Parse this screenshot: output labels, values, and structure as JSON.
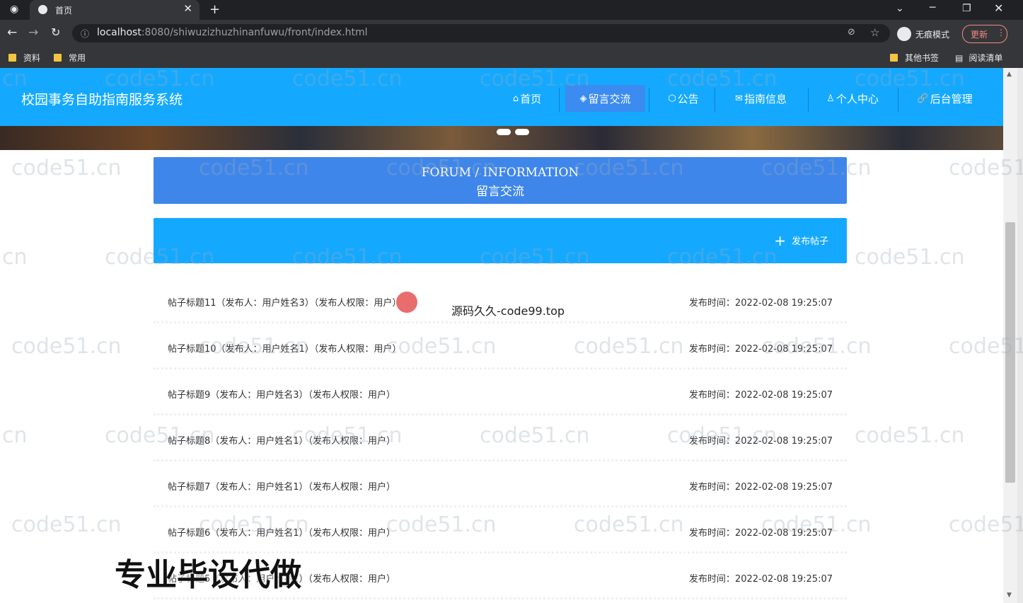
{
  "browser": {
    "tab_title": "首页",
    "url_host": "localhost",
    "url_path": ":8080/shiwuzizhuzhinanfuwu/front/index.html",
    "bookmarks": [
      "资料",
      "常用"
    ],
    "bookmarks_right": [
      "其他书签",
      "阅读清单"
    ],
    "incognito_label": "无痕模式",
    "update_label": "更新"
  },
  "nav": {
    "site_title": "校园事务自助指南服务系统",
    "items": [
      {
        "icon": "home-icon",
        "glyph": "⌂",
        "label": "首页"
      },
      {
        "icon": "tag-icon",
        "glyph": "◈",
        "label": "留言交流"
      },
      {
        "icon": "box-icon",
        "glyph": "⬡",
        "label": "公告"
      },
      {
        "icon": "mail-icon",
        "glyph": "✉",
        "label": "指南信息"
      },
      {
        "icon": "user-icon",
        "glyph": "♙",
        "label": "个人中心"
      },
      {
        "icon": "link-icon",
        "glyph": "🔗",
        "label": "后台管理"
      }
    ],
    "active_index": 1
  },
  "header": {
    "title_en": "FORUM / INFORMATION",
    "title_cn": "留言交流"
  },
  "actions": {
    "add_label": "发布帖子"
  },
  "posts": [
    {
      "title": "帖子标题11（发布人：用户姓名3）（发布人权限：用户）",
      "time": "发布时间：2022-02-08 19:25:07"
    },
    {
      "title": "帖子标题10（发布人：用户姓名1）（发布人权限：用户）",
      "time": "发布时间：2022-02-08 19:25:07"
    },
    {
      "title": "帖子标题9（发布人：用户姓名3）（发布人权限：用户）",
      "time": "发布时间：2022-02-08 19:25:07"
    },
    {
      "title": "帖子标题8（发布人：用户姓名1）（发布人权限：用户）",
      "time": "发布时间：2022-02-08 19:25:07"
    },
    {
      "title": "帖子标题7（发布人：用户姓名1）（发布人权限：用户）",
      "time": "发布时间：2022-02-08 19:25:07"
    },
    {
      "title": "帖子标题6（发布人：用户姓名1）（发布人权限：用户）",
      "time": "发布时间：2022-02-08 19:25:07"
    },
    {
      "title": "帖子标题5（发布人：用户姓名1）（发布人权限：用户）",
      "time": "发布时间：2022-02-08 19:25:07"
    }
  ],
  "overlays": {
    "watermark": "code51.cn",
    "code_text": "源码久久-code99.top",
    "big_text": "专业毕设代做"
  }
}
